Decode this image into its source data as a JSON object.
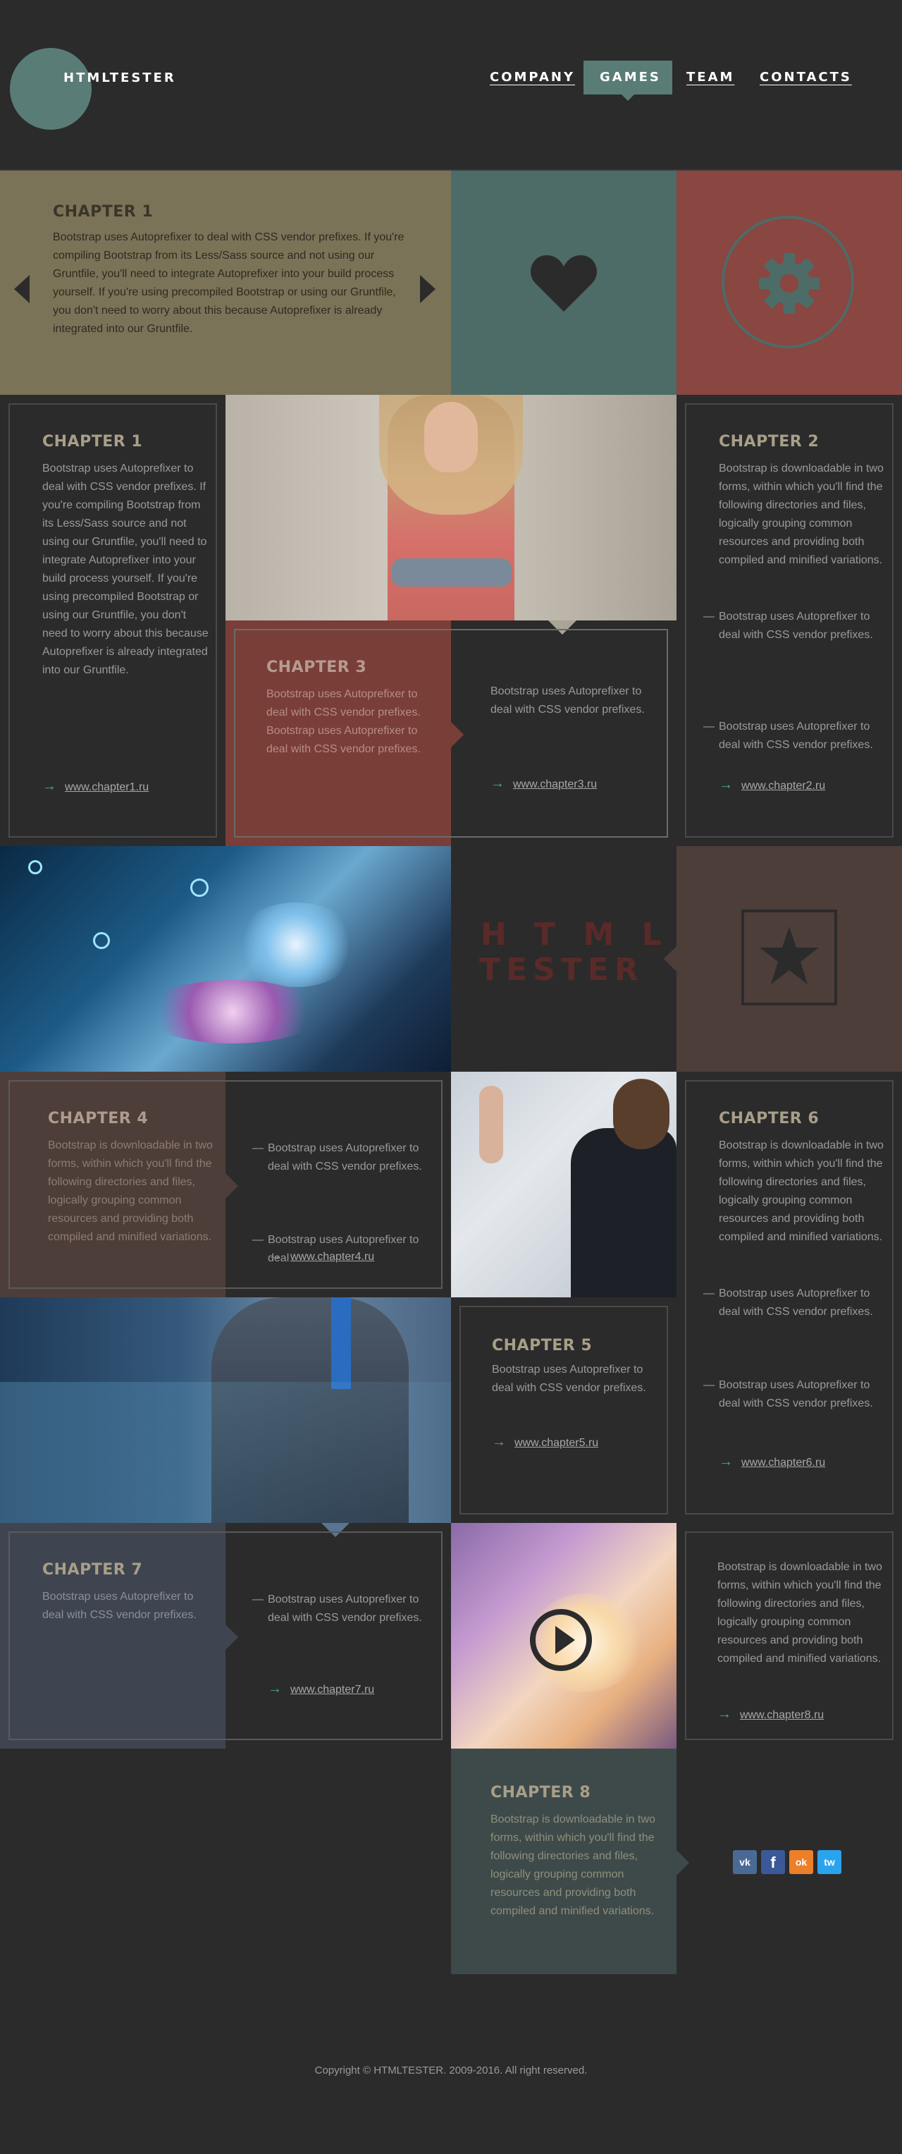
{
  "header": {
    "logo": "HTMLTESTER",
    "nav": [
      "COMPANY",
      "GAMES",
      "TEAM",
      "CONTACTS"
    ],
    "active": "GAMES"
  },
  "slider": {
    "title": "CHAPTER 1",
    "text": "Bootstrap uses Autoprefixer to deal with CSS vendor prefixes. If you're compiling Bootstrap from its Less/Sass source and not using our Gruntfile, you'll need to integrate Autoprefixer into your build process yourself. If you're using precompiled Bootstrap or using our Gruntfile, you don't need to worry about this because Autoprefixer is already integrated into our Gruntfile."
  },
  "ch1": {
    "title": "CHAPTER 1",
    "text": "Bootstrap uses Autoprefixer to deal with CSS vendor prefixes. If you're compiling Bootstrap from its Less/Sass source and not using our Gruntfile, you'll need to integrate Autoprefixer into your build process yourself. If you're using precompiled Bootstrap or using our Gruntfile, you don't need to worry about this because Autoprefixer is already integrated into our Gruntfile.",
    "link": "www.chapter1.ru"
  },
  "ch2": {
    "title": "CHAPTER 2",
    "text": "Bootstrap is downloadable in two forms, within which you'll find the following directories and files, logically grouping common resources and providing both compiled and minified variations.",
    "items": [
      "Bootstrap uses Autoprefixer to deal with CSS vendor prefixes.",
      "Bootstrap uses Autoprefixer to deal with CSS vendor prefixes."
    ],
    "link": "www.chapter2.ru"
  },
  "ch3": {
    "title": "CHAPTER 3",
    "text": "Bootstrap uses Autoprefixer to deal with CSS vendor prefixes. Bootstrap uses Autoprefixer to deal with CSS vendor prefixes.",
    "text2": "Bootstrap uses Autoprefixer to deal with CSS vendor prefixes.",
    "link": "www.chapter3.ru"
  },
  "brand": {
    "line1": "H T M L",
    "line2": "TESTER"
  },
  "ch4": {
    "title": "CHAPTER 4",
    "text": "Bootstrap is downloadable in two forms, within which you'll find the following directories and files, logically grouping common resources and providing both compiled and minified variations.",
    "items": [
      "Bootstrap uses Autoprefixer to deal with CSS vendor prefixes.",
      "Bootstrap uses Autoprefixer to deal ."
    ],
    "link": "www.chapter4.ru"
  },
  "ch5": {
    "title": "CHAPTER 5",
    "text": "Bootstrap uses Autoprefixer to deal with CSS vendor prefixes.",
    "link": "www.chapter5.ru"
  },
  "ch6": {
    "title": "CHAPTER 6",
    "text": "Bootstrap is downloadable in two forms, within which you'll find the following directories and files, logically grouping common resources and providing both compiled and minified variations.",
    "items": [
      "Bootstrap uses Autoprefixer to deal with CSS vendor prefixes.",
      "Bootstrap uses Autoprefixer to deal with CSS vendor prefixes."
    ],
    "link": "www.chapter6.ru"
  },
  "ch7": {
    "title": "CHAPTER 7",
    "text": "Bootstrap uses Autoprefixer to deal with CSS vendor prefixes.",
    "items": [
      "Bootstrap uses Autoprefixer to deal with CSS vendor prefixes."
    ],
    "link": "www.chapter7.ru"
  },
  "ch8card": {
    "text": "Bootstrap is downloadable in two forms, within which you'll find the following directories and files, logically grouping common resources and providing both compiled and minified variations.",
    "link": "www.chapter8.ru"
  },
  "ch8": {
    "title": "CHAPTER 8",
    "text": "Bootstrap is downloadable in two forms, within which you'll find the following directories and files, logically grouping common resources and providing both compiled and minified variations."
  },
  "social": {
    "vk": "vk",
    "fb": "f",
    "ok": "ok",
    "tw": "tw"
  },
  "footer": {
    "copyright": "Copyright © HTMLTESTER. 2009-2016. All right reserved."
  },
  "colors": {
    "olive": "#7a7358",
    "teal": "#4d6b67",
    "red": "#8a4640",
    "brown": "#4d3e3a",
    "slate": "#3f4550",
    "accent": "#4aa39a"
  }
}
